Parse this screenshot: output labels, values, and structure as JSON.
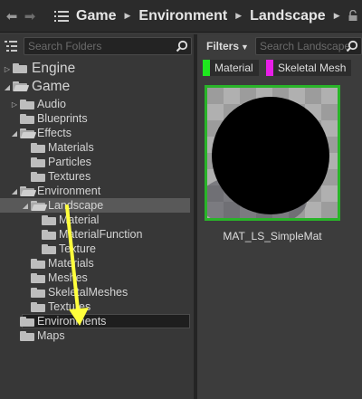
{
  "nav": {
    "breadcrumbs": [
      "Game",
      "Environment",
      "Landscape"
    ]
  },
  "left": {
    "search_placeholder": "Search Folders",
    "tree": [
      {
        "label": "Engine",
        "depth": 0,
        "expanded": false,
        "big": true
      },
      {
        "label": "Game",
        "depth": 0,
        "expanded": true,
        "big": true
      },
      {
        "label": "Audio",
        "depth": 1,
        "expanded": false
      },
      {
        "label": "Blueprints",
        "depth": 1
      },
      {
        "label": "Effects",
        "depth": 1,
        "expanded": true
      },
      {
        "label": "Materials",
        "depth": 2
      },
      {
        "label": "Particles",
        "depth": 2
      },
      {
        "label": "Textures",
        "depth": 2
      },
      {
        "label": "Environment",
        "depth": 1,
        "expanded": true
      },
      {
        "label": "Landscape",
        "depth": 2,
        "expanded": true,
        "selected": true
      },
      {
        "label": "Material",
        "depth": 3
      },
      {
        "label": "MaterialFunction",
        "depth": 3
      },
      {
        "label": "Texture",
        "depth": 3
      },
      {
        "label": "Materials",
        "depth": 2
      },
      {
        "label": "Meshes",
        "depth": 2
      },
      {
        "label": "SkeletalMeshes",
        "depth": 2
      },
      {
        "label": "Textures",
        "depth": 2
      },
      {
        "label": "Environments",
        "depth": 1,
        "drop_target": true
      },
      {
        "label": "Maps",
        "depth": 1
      }
    ]
  },
  "right": {
    "filters_label": "Filters",
    "search_placeholder": "Search Landscape",
    "chips": [
      {
        "label": "Material",
        "color": "#1ee81e"
      },
      {
        "label": "Skeletal Mesh",
        "color": "#e81ee8"
      }
    ],
    "asset": {
      "name": "MAT_LS_SimpleMat",
      "border_color": "#29b429"
    }
  },
  "colors": {
    "arrow": "#ffff3c"
  }
}
